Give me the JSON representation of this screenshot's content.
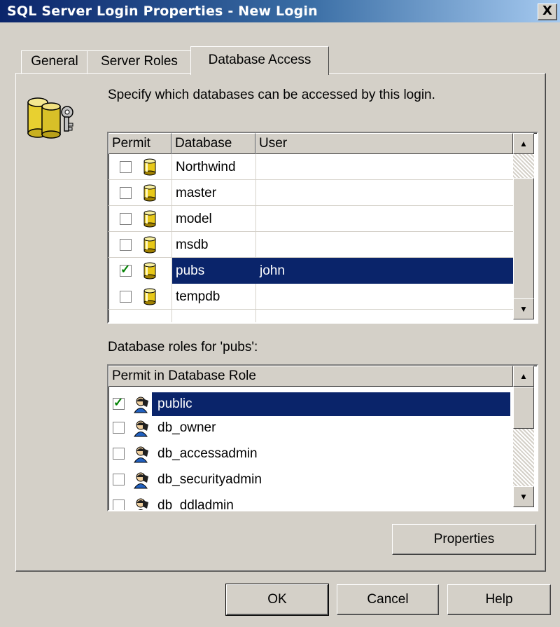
{
  "window": {
    "title": "SQL Server Login Properties - New Login",
    "close_label": "X"
  },
  "tabs": [
    {
      "label": "General"
    },
    {
      "label": "Server Roles"
    },
    {
      "label": "Database Access"
    }
  ],
  "hint": "Specify which databases can be accessed by this login.",
  "databases": {
    "headers": {
      "permit": "Permit",
      "database": "Database",
      "user": "User"
    },
    "rows": [
      {
        "name": "Northwind",
        "user": "",
        "checked": false,
        "selected": false
      },
      {
        "name": "master",
        "user": "",
        "checked": false,
        "selected": false
      },
      {
        "name": "model",
        "user": "",
        "checked": false,
        "selected": false
      },
      {
        "name": "msdb",
        "user": "",
        "checked": false,
        "selected": false
      },
      {
        "name": "pubs",
        "user": "john",
        "checked": true,
        "selected": true
      },
      {
        "name": "tempdb",
        "user": "",
        "checked": false,
        "selected": false
      }
    ]
  },
  "roles_label": "Database roles for 'pubs':",
  "roles": {
    "header": "Permit in Database Role",
    "rows": [
      {
        "name": "public",
        "checked": true,
        "selected": true
      },
      {
        "name": "db_owner",
        "checked": false,
        "selected": false
      },
      {
        "name": "db_accessadmin",
        "checked": false,
        "selected": false
      },
      {
        "name": "db_securityadmin",
        "checked": false,
        "selected": false
      },
      {
        "name": "db_ddladmin",
        "checked": false,
        "selected": false
      }
    ]
  },
  "buttons": {
    "properties": "Properties",
    "ok": "OK",
    "cancel": "Cancel",
    "help": "Help"
  },
  "icons": {
    "database": "database-cylinder-icon",
    "role": "user-role-icon",
    "login": "database-key-icon"
  },
  "colors": {
    "face": "#d4d0c8",
    "selection": "#0a246a",
    "title_start": "#0a246a",
    "title_end": "#a6caf0"
  }
}
